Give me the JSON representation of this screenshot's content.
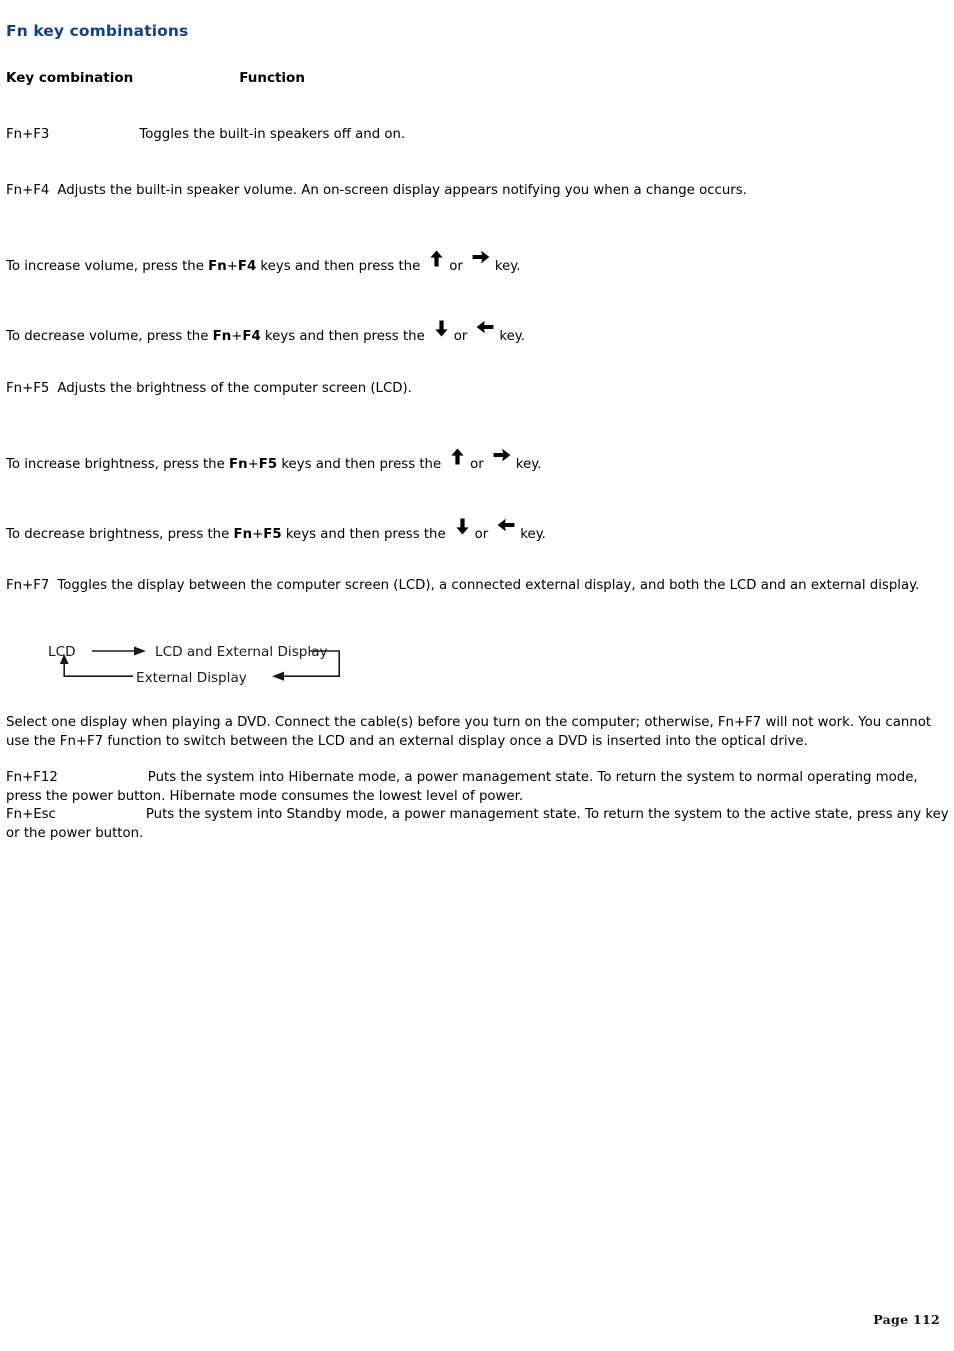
{
  "document": {
    "title": "Fn key combinations",
    "title_color": "#15417E",
    "page_label": "Page 112"
  },
  "table_headers": {
    "key_combination": "Key combination",
    "function": "Function"
  },
  "entries": {
    "fn_f3": {
      "key": "Fn+F3",
      "text": "Toggles the built-in speakers off and on."
    },
    "fn_f4": {
      "key": "Fn+F4",
      "text": "Adjusts the built-in speaker volume. An on-screen display appears notifying you when a change occurs."
    },
    "fn_f4_increase": {
      "lead": "To increase volume, press the ",
      "keys_bold": "Fn",
      "keys_plus": "+",
      "keys_bold2": "F4",
      "mid": " keys and then press the",
      "or": "or",
      "tail": "key.",
      "arrow_a": "up-arrow",
      "arrow_b": "right-arrow"
    },
    "fn_f4_decrease": {
      "lead": "To decrease volume, press the ",
      "keys_bold": "Fn",
      "keys_plus": "+",
      "keys_bold2": "F4",
      "mid": " keys and then press the",
      "or": "or",
      "tail": "key.",
      "arrow_a": "down-arrow",
      "arrow_b": "left-arrow"
    },
    "fn_f5": {
      "key": "Fn+F5",
      "text": "Adjusts the brightness of the computer screen (LCD)."
    },
    "fn_f5_increase": {
      "lead": "To increase brightness, press the ",
      "keys_bold": "Fn",
      "keys_plus": "+",
      "keys_bold2": "F5",
      "mid": " keys and then press the",
      "or": "or",
      "tail": "key.",
      "arrow_a": "up-arrow",
      "arrow_b": "right-arrow"
    },
    "fn_f5_decrease": {
      "lead": "To decrease brightness, press the ",
      "keys_bold": "Fn",
      "keys_plus": "+",
      "keys_bold2": "F5",
      "mid": " keys and then press the",
      "or": "or",
      "tail": "key.",
      "arrow_a": "down-arrow",
      "arrow_b": "left-arrow"
    },
    "fn_f7": {
      "key": "Fn+F7",
      "text": "Toggles the display between the computer screen (LCD), a connected external display, and both the LCD and an external display."
    },
    "dvd_note": {
      "text": "Select one display when playing a DVD. Connect the cable(s) before you turn on the computer; otherwise, Fn+F7 will not work. You cannot use the Fn+F7 function to switch between the LCD and an external display once a DVD is inserted into the optical drive."
    },
    "fn_f12": {
      "key": "Fn+F12",
      "text": "Puts the system into Hibernate mode, a power management state. To return the system to normal operating mode, press the power button. Hibernate mode consumes the lowest level of power."
    },
    "fn_esc": {
      "key": "Fn+Esc",
      "text": "Puts the system into Standby mode, a power management state. To return the system to the active state, press any key or the power button."
    }
  },
  "display_cycle_diagram": {
    "node_lcd": "LCD",
    "node_lcd_and_external": "LCD and External Display",
    "node_external": "External Display"
  }
}
